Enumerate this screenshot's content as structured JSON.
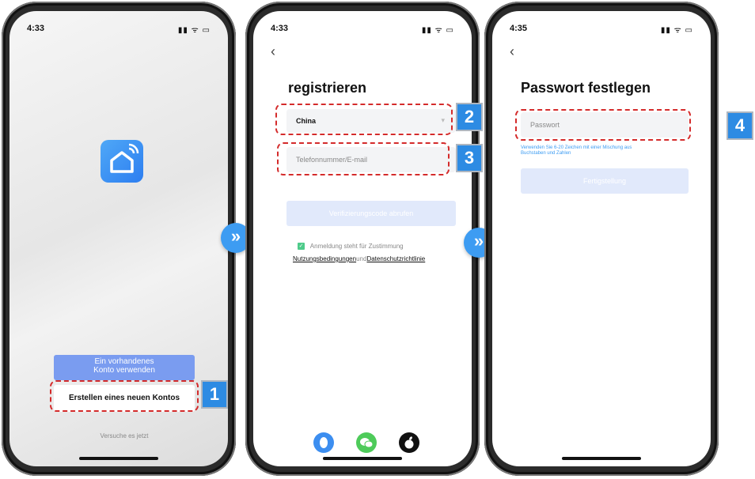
{
  "phone1": {
    "status_time": "4:33",
    "status_icons": "▮▮ ᯤ ▭",
    "login_button_line1": "Ein vorhandenes",
    "login_button_line2": "Konto verwenden",
    "create_account_button": "Erstellen eines neuen Kontos",
    "try_now_link": "Versuche es jetzt",
    "step_badge": "1"
  },
  "phone2": {
    "status_time": "4:33",
    "status_icons": "▮▮ ᯤ ▭",
    "back_icon": "‹",
    "title": "registrieren",
    "country_value": "China",
    "country_dropdown_icon": "▾",
    "phone_email_placeholder": "Telefonnummer/E-mail",
    "verify_button": "Verifizierungscode abrufen",
    "consent_text": "Anmeldung steht für Zustimmung",
    "terms_link": "Nutzungsbedingungen",
    "and_text": "und",
    "privacy_link": "Datenschutzrichtlinie",
    "badge_country": "2",
    "badge_phone": "3",
    "social": [
      "qq-icon",
      "wechat-icon",
      "apple-icon"
    ]
  },
  "phone3": {
    "status_time": "4:35",
    "status_icons": "▮▮ ᯤ ▭",
    "back_icon": "‹",
    "title": "Passwort festlegen",
    "password_placeholder": "Passwort",
    "hint_line1": "Verwenden Sie 6-20 Zeichen mit einer Mischung aus",
    "hint_line2": "Buchstaben und Zahlen",
    "finish_button": "Fertigstellung",
    "step_badge": "4"
  },
  "arrows": [
    "»",
    "»"
  ],
  "colors": {
    "accent_blue": "#3d9cf2",
    "button_blue": "#7a9cf0",
    "dash_red": "#d42b2b",
    "badge_blue": "#2d8be3"
  }
}
